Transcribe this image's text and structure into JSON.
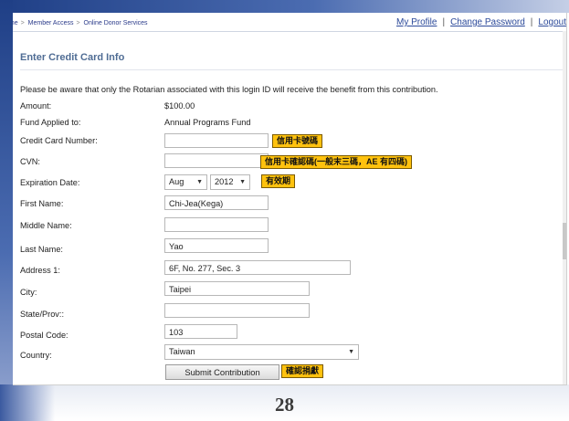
{
  "breadcrumb": [
    "ome",
    "Member Access",
    "Online Donor Services"
  ],
  "top_links": [
    "My Profile",
    "Change Password",
    "Logout"
  ],
  "page": {
    "title": "Enter Credit Card Info",
    "notice": "Please be aware that only the Rotarian associated with this login ID will receive the benefit from this contribution."
  },
  "form": {
    "amount_label": "Amount:",
    "amount_value": "$100.00",
    "fund_label": "Fund Applied to:",
    "fund_value": "Annual Programs Fund",
    "card_label": "Credit Card Number:",
    "card_value": "",
    "cvn_label": "CVN:",
    "cvn_value": "",
    "exp_label": "Expiration Date:",
    "exp_month": "Aug",
    "exp_year": "2012",
    "first_label": "First Name:",
    "first_value": "Chi-Jea(Kega)",
    "middle_label": "Middle Name:",
    "middle_value": "",
    "last_label": "Last Name:",
    "last_value": "Yao",
    "addr_label": "Address 1:",
    "addr_value": "6F, No. 277, Sec. 3",
    "city_label": "City:",
    "city_value": "Taipei",
    "state_label": "State/Prov::",
    "state_value": "",
    "postal_label": "Postal Code:",
    "postal_value": "103",
    "country_label": "Country:",
    "country_value": "Taiwan",
    "submit_label": "Submit Contribution"
  },
  "annotations": {
    "card": "信用卡號碼",
    "cvn": "信用卡確認碼(一般末三碼，AE 有四碼)",
    "exp": "有效期",
    "submit": "確認捐獻"
  },
  "slide_number": "28",
  "colors": {
    "annotation_bg": "#ffc20e",
    "title_color": "#4f6c94",
    "link_color": "#2c4a9a"
  }
}
